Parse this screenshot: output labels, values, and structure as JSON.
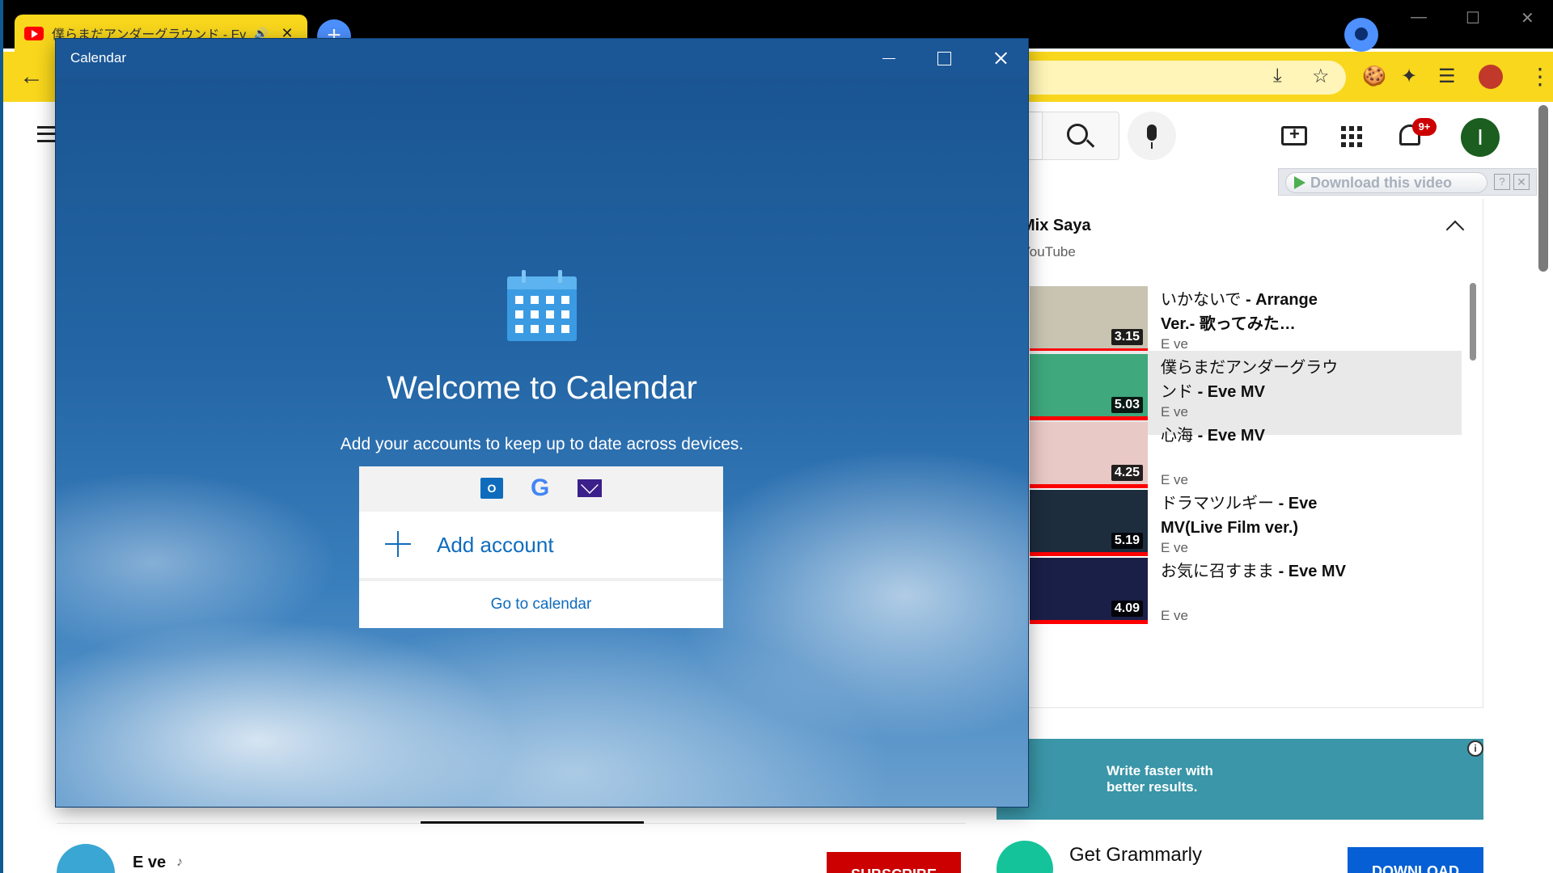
{
  "browser": {
    "tab_title": "僕らまだアンダーグラウンド - Eve",
    "newtab_label": "+",
    "back_icon": "arrow-left-icon"
  },
  "youtube": {
    "notif_count": "9+",
    "avatar_letter": "I",
    "download_bar": {
      "label": "Download this video",
      "help": "?",
      "close": "✕"
    },
    "playlist": {
      "title": "Mix Saya",
      "subtitle": "YouTube",
      "items": [
        {
          "title_jp": "いかないで",
          "title_rest": "- Arrange Ver.- 歌ってみた…",
          "channel": "E ve",
          "duration": "3.15",
          "thumb_color": "#c9c4b2",
          "active": false
        },
        {
          "title_jp": "僕らまだアンダーグラウンド",
          "title_rest": "- Eve MV",
          "channel": "E ve",
          "duration": "5.03",
          "thumb_color": "#3fa87d",
          "active": true
        },
        {
          "title_jp": "心海",
          "title_rest": "- Eve MV",
          "channel": "E ve",
          "duration": "4.25",
          "thumb_color": "#e9c9c5",
          "active": false
        },
        {
          "title_jp": "ドラマツルギー",
          "title_rest": "- Eve MV(Live Film ver.)",
          "channel": "E ve",
          "duration": "5.19",
          "thumb_color": "#1d2d3e",
          "active": false
        },
        {
          "title_jp": "お気に召すまま",
          "title_rest": "- Eve MV",
          "channel": "E ve",
          "duration": "4.09",
          "thumb_color": "#1a1f48",
          "active": false
        }
      ]
    },
    "ad": {
      "banner_text": "Write faster with better results.",
      "info": "i",
      "advertiser": "Get Grammarly",
      "cta": "DOWNLOAD"
    },
    "channel": {
      "name": "E ve",
      "subscribe": "SUBSCRIBE"
    }
  },
  "calendar": {
    "window_title": "Calendar",
    "welcome": "Welcome to Calendar",
    "subtitle": "Add your accounts to keep up to date across devices.",
    "add_account": "Add account",
    "go_to_calendar": "Go to calendar",
    "outlook_letter": "O",
    "google_letter": "G"
  }
}
